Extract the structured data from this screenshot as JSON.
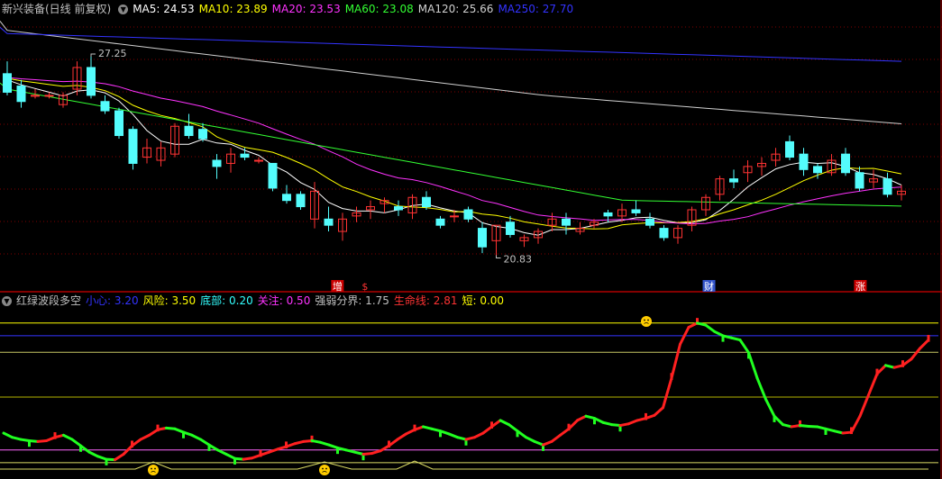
{
  "stock": {
    "title": "新兴装备(日线 前复权)"
  },
  "ma_legend": [
    {
      "label": "MA5: 24.53",
      "color": "#ffffff"
    },
    {
      "label": "MA10: 23.89",
      "color": "#ffff00"
    },
    {
      "label": "MA20: 23.53",
      "color": "#ff33ff"
    },
    {
      "label": "MA60: 23.08",
      "color": "#33ff33"
    },
    {
      "label": "MA120: 25.66",
      "color": "#d0d0d0"
    },
    {
      "label": "MA250: 27.70",
      "color": "#3333ff"
    }
  ],
  "indicator": {
    "title": "红绿波段多空",
    "params": [
      {
        "label": "小心: 3.20",
        "color": "#3333ff"
      },
      {
        "label": "风险: 3.50",
        "color": "#ffff00"
      },
      {
        "label": "底部: 0.20",
        "color": "#33ffff"
      },
      {
        "label": "关注: 0.50",
        "color": "#ff33ff"
      },
      {
        "label": "强弱分界: 1.75",
        "color": "#c0c0c0"
      },
      {
        "label": "生命线: 2.81",
        "color": "#ff3333"
      },
      {
        "label": "短: 0.00",
        "color": "#ffff00"
      }
    ]
  },
  "price_annotations": {
    "high": "27.25",
    "low": "20.83"
  },
  "event_markers": [
    {
      "label": "增",
      "color": "#ffffff",
      "bg": "#cc0000",
      "bar": 24
    },
    {
      "label": "$",
      "color": "#ff3333",
      "bg": "",
      "bar": 26
    },
    {
      "label": "财",
      "color": "#ffffff",
      "bg": "#3355cc",
      "bar": 51
    },
    {
      "label": "涨",
      "color": "#ffffff",
      "bg": "#cc0000",
      "bar": 62
    }
  ],
  "colors": {
    "up": "#ff3333",
    "down": "#54fcfc",
    "grid": "#800000",
    "divider": "#b00000"
  },
  "chart_data": [
    {
      "type": "candlestick",
      "title": "新兴装备(日线 前复权)",
      "ylim": [
        20.0,
        28.5
      ],
      "candles": [
        [
          26.7,
          27.1,
          26.0,
          26.1
        ],
        [
          26.3,
          26.5,
          25.6,
          25.8
        ],
        [
          26.0,
          26.2,
          25.9,
          26.0
        ],
        [
          26.0,
          26.1,
          25.9,
          26.0
        ],
        [
          25.7,
          26.1,
          25.6,
          26.0
        ],
        [
          26.2,
          27.1,
          26.0,
          26.9
        ],
        [
          26.9,
          27.25,
          25.9,
          26.0
        ],
        [
          25.8,
          26.0,
          25.4,
          25.5
        ],
        [
          25.5,
          25.6,
          24.6,
          24.7
        ],
        [
          24.9,
          25.0,
          23.6,
          23.8
        ],
        [
          24.0,
          24.6,
          23.8,
          24.3
        ],
        [
          23.9,
          24.5,
          23.7,
          24.3
        ],
        [
          24.1,
          25.1,
          24.0,
          25.0
        ],
        [
          25.0,
          25.4,
          24.6,
          24.7
        ],
        [
          24.9,
          25.1,
          24.5,
          24.6
        ],
        [
          23.9,
          24.1,
          23.3,
          23.7
        ],
        [
          23.8,
          24.3,
          23.5,
          24.1
        ],
        [
          24.1,
          24.3,
          23.9,
          24.0
        ],
        [
          23.9,
          24.0,
          23.8,
          23.9
        ],
        [
          23.8,
          23.8,
          22.9,
          23.0
        ],
        [
          22.8,
          23.1,
          22.5,
          22.6
        ],
        [
          22.8,
          22.9,
          22.3,
          22.4
        ],
        [
          22.0,
          23.2,
          21.7,
          22.9
        ],
        [
          22.0,
          22.4,
          21.6,
          21.8
        ],
        [
          21.6,
          22.2,
          21.3,
          22.0
        ],
        [
          22.1,
          22.4,
          21.9,
          22.2
        ],
        [
          22.3,
          22.6,
          22.0,
          22.4
        ],
        [
          22.5,
          22.7,
          22.2,
          22.6
        ],
        [
          22.4,
          22.6,
          22.1,
          22.3
        ],
        [
          22.2,
          22.8,
          22.0,
          22.7
        ],
        [
          22.7,
          22.9,
          22.3,
          22.4
        ],
        [
          22.0,
          22.1,
          21.7,
          21.8
        ],
        [
          22.1,
          22.3,
          21.9,
          22.1
        ],
        [
          22.3,
          22.4,
          21.9,
          22.0
        ],
        [
          21.7,
          21.9,
          20.9,
          21.1
        ],
        [
          21.3,
          21.8,
          20.83,
          21.8
        ],
        [
          21.9,
          22.1,
          21.4,
          21.5
        ],
        [
          21.3,
          21.5,
          21.1,
          21.4
        ],
        [
          21.4,
          21.7,
          21.2,
          21.6
        ],
        [
          21.8,
          22.2,
          21.6,
          22.0
        ],
        [
          22.0,
          22.2,
          21.5,
          21.8
        ],
        [
          21.6,
          21.9,
          21.5,
          21.7
        ],
        [
          21.8,
          22.0,
          21.7,
          21.9
        ],
        [
          22.2,
          22.3,
          21.9,
          22.1
        ],
        [
          22.1,
          22.5,
          21.9,
          22.3
        ],
        [
          22.3,
          22.6,
          22.1,
          22.2
        ],
        [
          22.0,
          22.2,
          21.7,
          21.8
        ],
        [
          21.7,
          21.8,
          21.3,
          21.4
        ],
        [
          21.4,
          21.8,
          21.2,
          21.7
        ],
        [
          21.8,
          22.4,
          21.6,
          22.3
        ],
        [
          22.3,
          22.8,
          22.1,
          22.7
        ],
        [
          22.8,
          23.4,
          22.6,
          23.3
        ],
        [
          23.3,
          23.6,
          23.0,
          23.2
        ],
        [
          23.5,
          23.9,
          23.2,
          23.7
        ],
        [
          23.7,
          24.0,
          23.4,
          23.8
        ],
        [
          23.9,
          24.3,
          23.7,
          24.1
        ],
        [
          24.5,
          24.7,
          23.9,
          24.0
        ],
        [
          24.1,
          24.3,
          23.4,
          23.6
        ],
        [
          23.7,
          23.8,
          23.3,
          23.5
        ],
        [
          23.5,
          24.1,
          23.4,
          23.9
        ],
        [
          24.1,
          24.3,
          23.4,
          23.5
        ],
        [
          23.5,
          23.7,
          22.9,
          23.0
        ],
        [
          23.2,
          23.6,
          23.0,
          23.3
        ],
        [
          23.3,
          23.5,
          22.7,
          22.8
        ],
        [
          22.8,
          23.1,
          22.6,
          22.9
        ]
      ],
      "ma_series": [
        {
          "name": "MA5",
          "color": "#ffffff"
        },
        {
          "name": "MA10",
          "color": "#ffff00"
        },
        {
          "name": "MA20",
          "color": "#ff33ff"
        },
        {
          "name": "MA60",
          "color": "#33ff33"
        },
        {
          "name": "MA120",
          "color": "#d0d0d0"
        },
        {
          "name": "MA250",
          "color": "#3333ff"
        }
      ]
    },
    {
      "type": "line",
      "title": "红绿波段多空",
      "ylim": [
        -0.1,
        3.9
      ],
      "values": [
        0.9,
        0.8,
        0.75,
        0.72,
        0.7,
        0.72,
        0.8,
        0.85,
        0.75,
        0.6,
        0.45,
        0.35,
        0.28,
        0.27,
        0.4,
        0.6,
        0.75,
        0.85,
        0.98,
        1.02,
        1.0,
        0.92,
        0.85,
        0.75,
        0.62,
        0.5,
        0.4,
        0.3,
        0.28,
        0.31,
        0.38,
        0.45,
        0.52,
        0.58,
        0.65,
        0.7,
        0.72,
        0.68,
        0.62,
        0.55,
        0.5,
        0.45,
        0.4,
        0.42,
        0.48,
        0.6,
        0.75,
        0.88,
        0.98,
        1.05,
        1.0,
        0.95,
        0.88,
        0.8,
        0.75,
        0.8,
        0.9,
        1.05,
        1.2,
        1.1,
        0.95,
        0.8,
        0.7,
        0.62,
        0.7,
        0.85,
        1.0,
        1.2,
        1.3,
        1.25,
        1.15,
        1.1,
        1.08,
        1.12,
        1.2,
        1.25,
        1.32,
        1.5,
        2.2,
        3.0,
        3.4,
        3.5,
        3.45,
        3.3,
        3.2,
        3.15,
        3.1,
        2.8,
        2.2,
        1.7,
        1.3,
        1.1,
        1.05,
        1.08,
        1.06,
        1.05,
        1.0,
        0.95,
        0.9,
        0.92,
        1.3,
        1.8,
        2.3,
        2.5,
        2.45,
        2.5,
        2.65,
        2.9,
        3.1
      ],
      "reference_lines": [
        {
          "name": "风险",
          "value": 3.5,
          "color": "#ffff00"
        },
        {
          "name": "小心",
          "value": 3.2,
          "color": "#3333ff"
        },
        {
          "name": "生命线",
          "value": 2.81,
          "color": "#c8c864"
        },
        {
          "name": "强弱分界",
          "value": 1.75,
          "color": "#b4b400"
        },
        {
          "name": "关注",
          "value": 0.5,
          "color": "#ff66ff"
        },
        {
          "name": "底部",
          "value": 0.2,
          "color": "#dddd66"
        }
      ]
    }
  ]
}
